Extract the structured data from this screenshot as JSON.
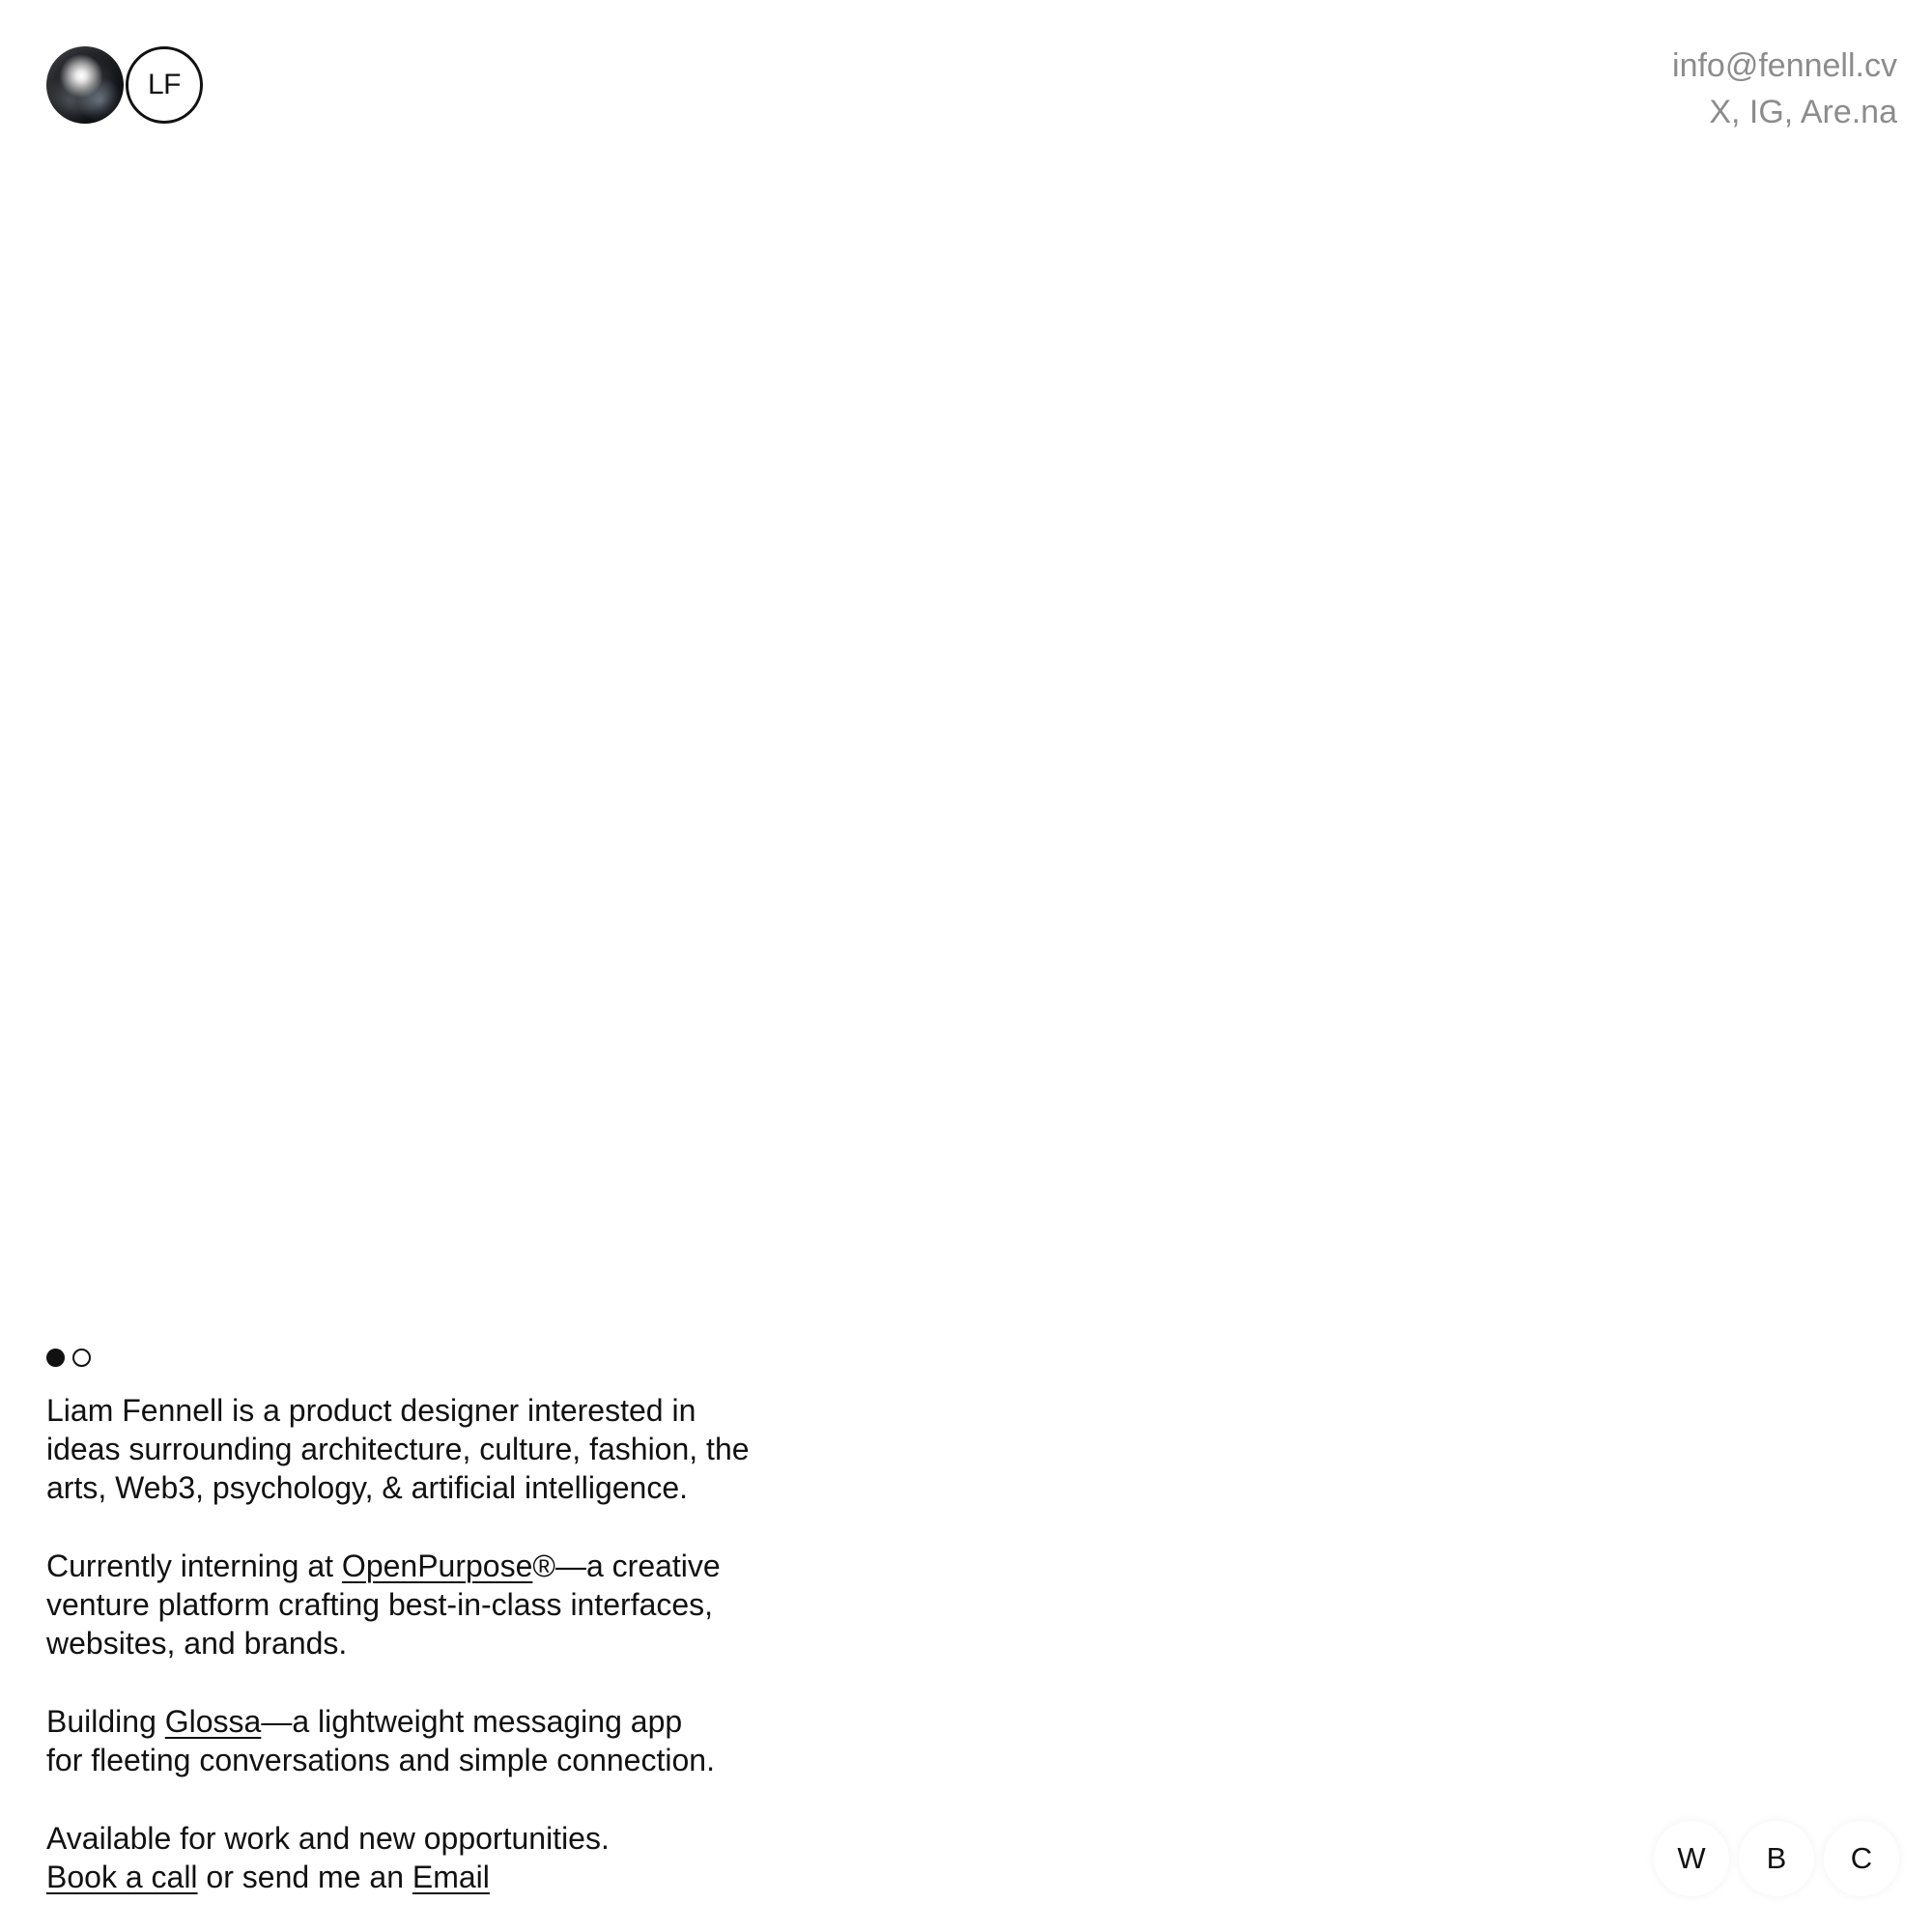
{
  "header": {
    "monogram": "LF",
    "contact": {
      "email": "info@fennell.cv",
      "socials": "X, IG, Are.na"
    }
  },
  "slider": {
    "total": 2,
    "active_index": 0
  },
  "bio": {
    "intro_lines": [
      "Liam Fennell is a product designer interested in",
      "ideas surrounding architecture, culture, fashion, the",
      "arts, Web3, psychology, & artificial intelligence."
    ],
    "intern": {
      "prefix": "Currently interning at ",
      "link": "OpenPurpose",
      "suffix_line1": "®—a creative",
      "line2": "venture platform crafting best-in-class interfaces,",
      "line3": "websites, and brands."
    },
    "building": {
      "prefix": "Building ",
      "link": "Glossa",
      "suffix_line1": "—a lightweight messaging app",
      "line2": "for fleeting conversations and simple connection."
    },
    "availability": {
      "line1": "Available for work and new opportunities.",
      "book_link": "Book a call",
      "middle": " or send me an ",
      "email_link": "Email"
    }
  },
  "nav": {
    "items": [
      "W",
      "B",
      "C"
    ]
  }
}
